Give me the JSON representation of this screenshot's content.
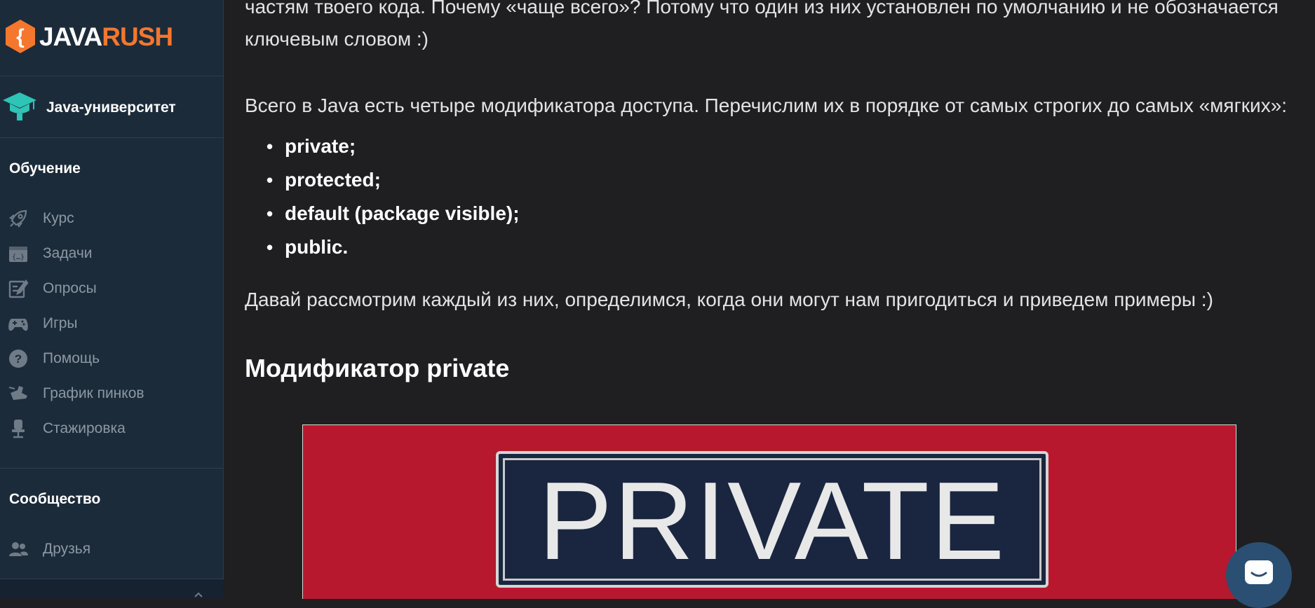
{
  "brand": {
    "java": "JAVA",
    "rush": "RUSH",
    "accent": "#f4772d"
  },
  "sidebar": {
    "university": {
      "label": "Java-университет",
      "icon": "graduation-cap-icon"
    },
    "sections": [
      {
        "title": "Обучение"
      },
      {
        "title": "Сообщество"
      }
    ],
    "learning_items": [
      {
        "label": "Курс",
        "icon": "rocket-icon"
      },
      {
        "label": "Задачи",
        "icon": "code-window-icon"
      },
      {
        "label": "Опросы",
        "icon": "edit-checklist-icon"
      },
      {
        "label": "Игры",
        "icon": "gamepad-icon"
      },
      {
        "label": "Помощь",
        "icon": "help-circle-icon"
      },
      {
        "label": "График пинков",
        "icon": "boot-kick-icon"
      },
      {
        "label": "Стажировка",
        "icon": "office-chair-icon"
      }
    ],
    "community_items": [
      {
        "label": "Друзья",
        "icon": "users-icon"
      }
    ]
  },
  "article": {
    "intro_line1": "частям твоего кода. Почему «чаще всего»? Потому что один из них установлен по умолчанию и не обозначается",
    "intro_line2": "ключевым словом :)",
    "modifiers_intro": "Всего в Java есть четыре модификатора доступа. Перечислим их в порядке от самых строгих до самых «мягких»:",
    "modifiers": [
      "private;",
      "protected;",
      "default (package visible);",
      "public."
    ],
    "outro": "Давай рассмотрим каждый из них, определимся, когда они могут нам пригодиться и приведем примеры :)",
    "heading": "Модификатор private",
    "image_sign_text": "PRIVATE"
  },
  "chat": {
    "icon": "chat-bubble-icon"
  }
}
